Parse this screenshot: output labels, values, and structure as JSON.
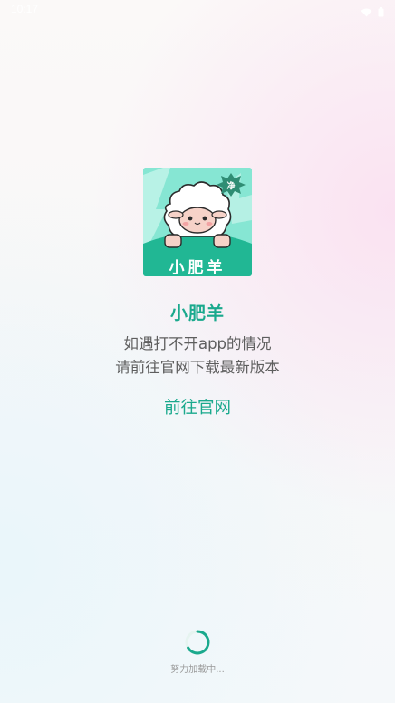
{
  "status_bar": {
    "time": "10:17"
  },
  "app": {
    "icon_name": "sheep-logo-icon",
    "icon_caption": "小肥羊",
    "badge_text": "净",
    "name": "小肥羊",
    "accent_color": "#1aa98d"
  },
  "notice": {
    "line1": "如遇打不开app的情况",
    "line2": "请前往官网下载最新版本"
  },
  "actions": {
    "go_website_label": "前往官网"
  },
  "loading": {
    "text": "努力加载中..."
  }
}
